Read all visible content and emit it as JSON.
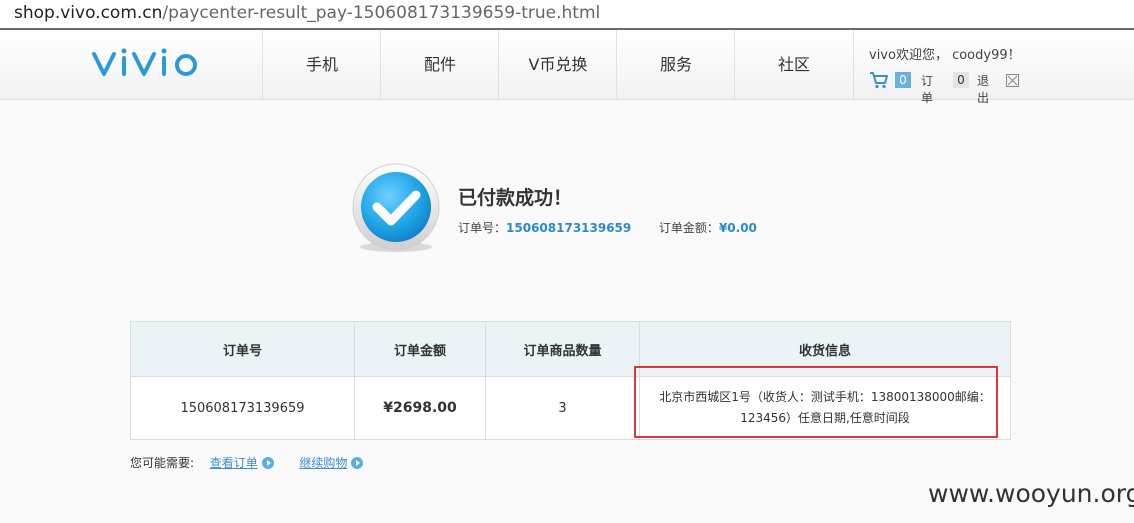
{
  "browser": {
    "url_host": "shop.vivo.com.cn",
    "url_path": "/paycenter-result_pay-150608173139659-true.html"
  },
  "header": {
    "logo": "vivo",
    "nav": [
      "手机",
      "配件",
      "V币兑换",
      "服务",
      "社区"
    ],
    "greeting": "vivo欢迎您， coody99！",
    "cart_count": "0",
    "orders_label": "订单",
    "orders_count": "0",
    "logout_label": "退出"
  },
  "result": {
    "title": "已付款成功！",
    "order_no_label": "订单号：",
    "order_no": "150608173139659",
    "amount_label": "订单金额：",
    "amount": "¥0.00"
  },
  "table": {
    "headers": [
      "订单号",
      "订单金额",
      "订单商品数量",
      "收货信息"
    ],
    "row": {
      "order_no": "150608173139659",
      "amount": "¥2698.00",
      "quantity": "3",
      "address_line1": "北京市西城区1号（收货人：测试手机：13800138000邮编：",
      "address_line2": "123456）任意日期,任意时间段"
    }
  },
  "suggest": {
    "label": "您可能需要:",
    "view_order": "查看订单",
    "continue_shopping": "继续购物"
  },
  "watermark": "www.wooyun.org",
  "colors": {
    "accent_blue": "#2a8bcc",
    "logo_blue": "#2b9ad8",
    "highlight_red": "#e0363e"
  }
}
